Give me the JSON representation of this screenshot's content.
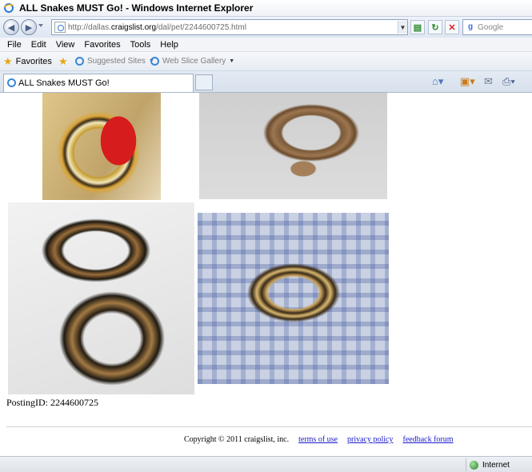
{
  "window": {
    "title": "ALL Snakes MUST Go! - Windows Internet Explorer"
  },
  "address_bar": {
    "url_prefix": "http://dallas.",
    "url_host": "craigslist.org",
    "url_path": "/dal/pet/2244600725.html",
    "search_placeholder": "Google"
  },
  "menu": {
    "items": [
      "File",
      "Edit",
      "View",
      "Favorites",
      "Tools",
      "Help"
    ]
  },
  "favorites_bar": {
    "favorites_label": "Favorites",
    "links": [
      "Suggested Sites",
      "Web Slice Gallery"
    ]
  },
  "tabs": {
    "active": "ALL Snakes MUST Go!"
  },
  "page": {
    "posting_id": "PostingID: 2244600725",
    "copyright": "Copyright © 2011 craigslist, inc.",
    "links": [
      "terms of use",
      "privacy policy",
      "feedback forum"
    ]
  },
  "status_bar": {
    "zone": "Internet"
  },
  "icons": {
    "back": "back-arrow-icon",
    "forward": "forward-arrow-icon",
    "refresh": "refresh-icon",
    "stop": "stop-icon",
    "home": "home-icon",
    "feeds": "feeds-icon",
    "mail": "mail-icon",
    "print": "print-icon"
  }
}
